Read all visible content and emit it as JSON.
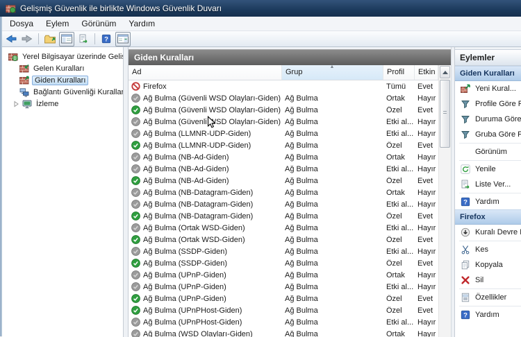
{
  "window": {
    "title": "Gelişmiş Güvenlik ile birlikte Windows Güvenlik Duvarı"
  },
  "menubar": {
    "items": [
      "Dosya",
      "Eylem",
      "Görünüm",
      "Yardım"
    ]
  },
  "toolbar": {
    "buttons": [
      {
        "name": "back",
        "icon": "back-arrow-icon",
        "boxed": false
      },
      {
        "name": "forward",
        "icon": "forward-arrow-icon",
        "boxed": false
      },
      {
        "name": "sep1",
        "icon": "separator",
        "boxed": false
      },
      {
        "name": "up-level",
        "icon": "folder-up-icon",
        "boxed": false
      },
      {
        "name": "toggle-console-tree",
        "icon": "console-tree-icon",
        "boxed": true
      },
      {
        "name": "export-list",
        "icon": "export-list-icon",
        "boxed": false
      },
      {
        "name": "sep2",
        "icon": "separator",
        "boxed": false
      },
      {
        "name": "help",
        "icon": "help-icon",
        "boxed": false
      },
      {
        "name": "toggle-action-pane",
        "icon": "action-pane-icon",
        "boxed": true
      }
    ]
  },
  "tree": {
    "root": {
      "label": "Yerel Bilgisayar üzerinde Gelişm",
      "icon": "firewall-root-icon"
    },
    "items": [
      {
        "label": "Gelen Kuralları",
        "icon": "inbound-rules-icon",
        "selected": false,
        "expandable": false
      },
      {
        "label": "Giden Kuralları",
        "icon": "outbound-rules-icon",
        "selected": true,
        "expandable": false
      },
      {
        "label": "Bağlantı Güvenliği Kuralları",
        "icon": "connection-security-icon",
        "selected": false,
        "expandable": false
      },
      {
        "label": "İzleme",
        "icon": "monitoring-icon",
        "selected": false,
        "expandable": true
      }
    ]
  },
  "list": {
    "title": "Giden Kuralları",
    "columns": [
      {
        "label": "Ad",
        "sorted": false
      },
      {
        "label": "Grup",
        "sorted": true
      },
      {
        "label": "Profil",
        "sorted": false
      },
      {
        "label": "Etkin",
        "sorted": false
      }
    ],
    "rows": [
      {
        "name": "Firefox",
        "group": "",
        "profile": "Tümü",
        "enabled": "Evet",
        "state": "blocked"
      },
      {
        "name": "Ağ Bulma (Güvenli WSD Olayları-Giden)",
        "group": "Ağ Bulma",
        "profile": "Ortak",
        "enabled": "Hayır",
        "state": "off"
      },
      {
        "name": "Ağ Bulma (Güvenli WSD Olayları-Giden)",
        "group": "Ağ Bulma",
        "profile": "Özel",
        "enabled": "Evet",
        "state": "on"
      },
      {
        "name": "Ağ Bulma (Güvenli WSD Olayları-Giden)",
        "group": "Ağ Bulma",
        "profile": "Etki al...",
        "enabled": "Hayır",
        "state": "off"
      },
      {
        "name": "Ağ Bulma (LLMNR-UDP-Giden)",
        "group": "Ağ Bulma",
        "profile": "Etki al...",
        "enabled": "Hayır",
        "state": "off"
      },
      {
        "name": "Ağ Bulma (LLMNR-UDP-Giden)",
        "group": "Ağ Bulma",
        "profile": "Özel",
        "enabled": "Evet",
        "state": "on"
      },
      {
        "name": "Ağ Bulma (NB-Ad-Giden)",
        "group": "Ağ Bulma",
        "profile": "Ortak",
        "enabled": "Hayır",
        "state": "off"
      },
      {
        "name": "Ağ Bulma (NB-Ad-Giden)",
        "group": "Ağ Bulma",
        "profile": "Etki al...",
        "enabled": "Hayır",
        "state": "off"
      },
      {
        "name": "Ağ Bulma (NB-Ad-Giden)",
        "group": "Ağ Bulma",
        "profile": "Özel",
        "enabled": "Evet",
        "state": "on"
      },
      {
        "name": "Ağ Bulma (NB-Datagram-Giden)",
        "group": "Ağ Bulma",
        "profile": "Ortak",
        "enabled": "Hayır",
        "state": "off"
      },
      {
        "name": "Ağ Bulma (NB-Datagram-Giden)",
        "group": "Ağ Bulma",
        "profile": "Etki al...",
        "enabled": "Hayır",
        "state": "off"
      },
      {
        "name": "Ağ Bulma (NB-Datagram-Giden)",
        "group": "Ağ Bulma",
        "profile": "Özel",
        "enabled": "Evet",
        "state": "on"
      },
      {
        "name": "Ağ Bulma (Ortak WSD-Giden)",
        "group": "Ağ Bulma",
        "profile": "Etki al...",
        "enabled": "Hayır",
        "state": "off"
      },
      {
        "name": "Ağ Bulma (Ortak WSD-Giden)",
        "group": "Ağ Bulma",
        "profile": "Özel",
        "enabled": "Evet",
        "state": "on"
      },
      {
        "name": "Ağ Bulma (SSDP-Giden)",
        "group": "Ağ Bulma",
        "profile": "Etki al...",
        "enabled": "Hayır",
        "state": "off"
      },
      {
        "name": "Ağ Bulma (SSDP-Giden)",
        "group": "Ağ Bulma",
        "profile": "Özel",
        "enabled": "Evet",
        "state": "on"
      },
      {
        "name": "Ağ Bulma (UPnP-Giden)",
        "group": "Ağ Bulma",
        "profile": "Ortak",
        "enabled": "Hayır",
        "state": "off"
      },
      {
        "name": "Ağ Bulma (UPnP-Giden)",
        "group": "Ağ Bulma",
        "profile": "Etki al...",
        "enabled": "Hayır",
        "state": "off"
      },
      {
        "name": "Ağ Bulma (UPnP-Giden)",
        "group": "Ağ Bulma",
        "profile": "Özel",
        "enabled": "Evet",
        "state": "on"
      },
      {
        "name": "Ağ Bulma (UPnPHost-Giden)",
        "group": "Ağ Bulma",
        "profile": "Özel",
        "enabled": "Evet",
        "state": "on"
      },
      {
        "name": "Ağ Bulma (UPnPHost-Giden)",
        "group": "Ağ Bulma",
        "profile": "Etki al...",
        "enabled": "Hayır",
        "state": "off"
      },
      {
        "name": "Ağ Bulma (WSD Olayları-Giden)",
        "group": "Ağ Bulma",
        "profile": "Ortak",
        "enabled": "Hayır",
        "state": "off"
      }
    ]
  },
  "actions": {
    "title": "Eylemler",
    "sections": [
      {
        "header": "Giden Kuralları",
        "items": [
          {
            "label": "Yeni Kural...",
            "icon": "new-rule-icon",
            "sep_before": false
          },
          {
            "label": "Profile Göre Fil",
            "icon": "filter-icon",
            "sep_before": false
          },
          {
            "label": "Duruma Göre F",
            "icon": "filter-icon",
            "sep_before": false
          },
          {
            "label": "Gruba Göre Filt",
            "icon": "filter-icon",
            "sep_before": false
          },
          {
            "label": "Görünüm",
            "icon": "",
            "sep_before": true
          },
          {
            "label": "Yenile",
            "icon": "refresh-icon",
            "sep_before": true
          },
          {
            "label": "Liste Ver...",
            "icon": "export-list-icon",
            "sep_before": false
          },
          {
            "label": "Yardım",
            "icon": "help-icon",
            "sep_before": true
          }
        ]
      },
      {
        "header": "Firefox",
        "items": [
          {
            "label": "Kuralı Devre Dı",
            "icon": "disable-rule-icon",
            "sep_before": false
          },
          {
            "label": "Kes",
            "icon": "cut-icon",
            "sep_before": true
          },
          {
            "label": "Kopyala",
            "icon": "copy-icon",
            "sep_before": false
          },
          {
            "label": "Sil",
            "icon": "delete-icon",
            "sep_before": false
          },
          {
            "label": "Özellikler",
            "icon": "properties-icon",
            "sep_before": true
          },
          {
            "label": "Yardım",
            "icon": "help-icon",
            "sep_before": true
          }
        ]
      }
    ]
  },
  "colors": {
    "title_bar": "#1c3a5c",
    "enabled_green": "#2f9e3f",
    "disabled_gray": "#979797",
    "blocked_red": "#c53b3b",
    "selection_blue": "#84acdd",
    "sorted_column": "#dcedfc",
    "list_header_gray": "#6b6b6b",
    "action_header_blue": "#aecbe9"
  }
}
